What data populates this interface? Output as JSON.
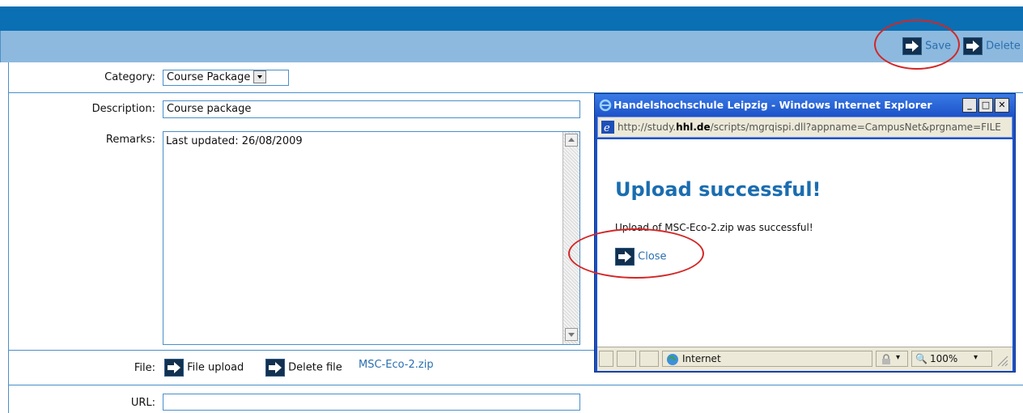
{
  "toolbar": {
    "save_label": "Save",
    "delete_label": "Delete"
  },
  "form": {
    "category_label": "Category:",
    "category_value": "Course Package",
    "description_label": "Description:",
    "description_value": "Course package",
    "remarks_label": "Remarks:",
    "remarks_value": "Last updated: 26/08/2009",
    "file_label": "File:",
    "file_upload_label": "File upload",
    "delete_file_label": "Delete file",
    "file_name": "MSC-Eco-2.zip",
    "url_label": "URL:",
    "url_value": ""
  },
  "popup": {
    "title": "Handelshochschule Leipzig - Windows Internet Explorer",
    "address_prefix": "http://study.",
    "address_domain": "hhl.de",
    "address_rest": "/scripts/mgrqispi.dll?appname=CampusNet&prgname=FILE",
    "heading": "Upload successful!",
    "message": "Upload of MSC-Eco-2.zip was successful!",
    "close_label": "Close",
    "status_zone": "Internet",
    "zoom": "100%"
  },
  "colors": {
    "brand": "#0a6fb3",
    "toolbar": "#8db9de",
    "link": "#2a6fb0",
    "heading": "#1a6db0",
    "annotation": "#d32626"
  }
}
